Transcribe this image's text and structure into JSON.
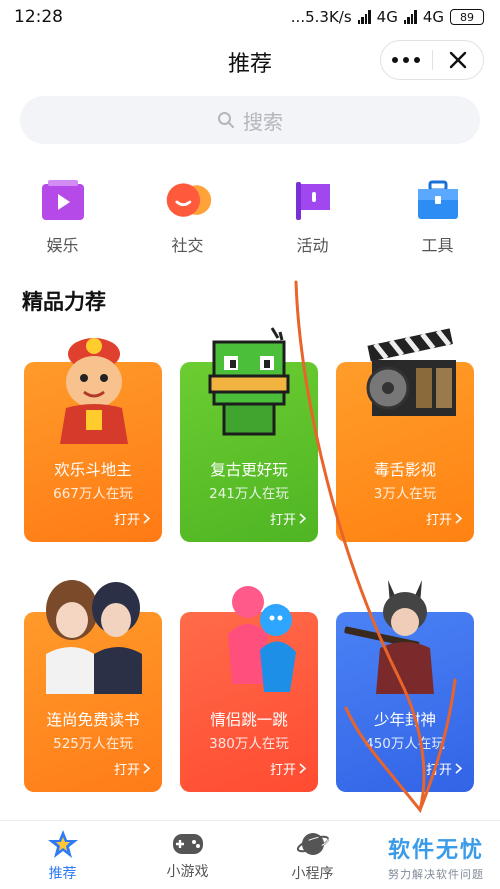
{
  "status_bar": {
    "time": "12:28",
    "network_speed": "...5.3K/s",
    "net1": "4G",
    "net2": "4G",
    "battery": "89"
  },
  "header": {
    "title": "推荐"
  },
  "search": {
    "placeholder": "搜索"
  },
  "categories": [
    {
      "label": "娱乐",
      "icon": "play-icon",
      "color": "#b54ae8"
    },
    {
      "label": "社交",
      "icon": "chat-bubble-icon",
      "color": "#ff5a3c"
    },
    {
      "label": "活动",
      "icon": "flag-icon",
      "color": "#a147f0"
    },
    {
      "label": "工具",
      "icon": "toolbox-icon",
      "color": "#2e8df5"
    }
  ],
  "section": {
    "title": "精品力荐"
  },
  "cards": [
    {
      "name": "欢乐斗地主",
      "players": "667万人在玩",
      "open": "打开",
      "color": "#ff8a1f"
    },
    {
      "name": "复古更好玩",
      "players": "241万人在玩",
      "open": "打开",
      "color": "#5ec12a"
    },
    {
      "name": "毒舌影视",
      "players": "3万人在玩",
      "open": "打开",
      "color": "#ff8e1a"
    },
    {
      "name": "连尚免费读书",
      "players": "525万人在玩",
      "open": "打开",
      "color": "#ff8a22"
    },
    {
      "name": "情侣跳一跳",
      "players": "380万人在玩",
      "open": "打开",
      "color": "#ff5a3d"
    },
    {
      "name": "少年封神",
      "players": "450万人在玩",
      "open": "打开",
      "color": "#3e73f0"
    }
  ],
  "tabs": [
    {
      "label": "推荐",
      "icon": "star-icon",
      "active": true
    },
    {
      "label": "小游戏",
      "icon": "gamepad-icon",
      "active": false
    },
    {
      "label": "小程序",
      "icon": "planet-icon",
      "active": false
    }
  ],
  "watermark": {
    "main": "软件无忧",
    "sub": "努力解决软件问题"
  }
}
